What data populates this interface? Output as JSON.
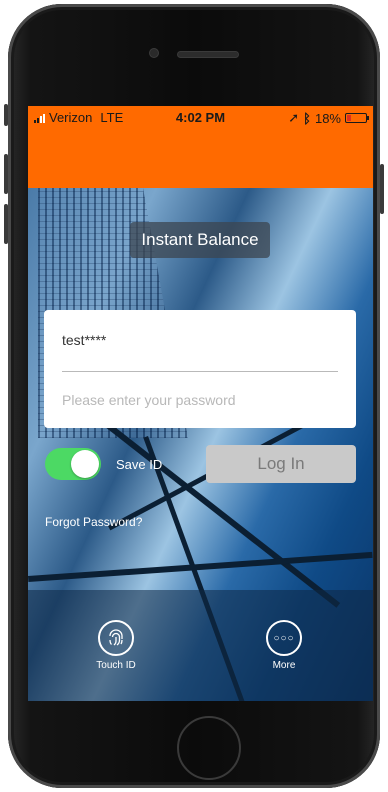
{
  "status_bar": {
    "carrier": "Verizon",
    "network": "LTE",
    "time": "4:02 PM",
    "battery": "18%",
    "icons": [
      "signal-icon",
      "location-icon",
      "bluetooth-icon",
      "battery-icon"
    ],
    "battery_color": "#e0301e"
  },
  "header": {
    "color": "#ff6a00"
  },
  "title": "Instant Balance",
  "login_form": {
    "username_value": "test****",
    "password_placeholder": "Please enter your password"
  },
  "save_id": {
    "label": "Save ID",
    "enabled": true,
    "toggle_color": "#4cd964"
  },
  "login_button": {
    "label": "Log In"
  },
  "forgot_password": "Forgot Password?",
  "bottom_actions": [
    {
      "label": "Touch ID",
      "icon": "fingerprint-icon"
    },
    {
      "label": "More",
      "icon": "more-dots-icon"
    }
  ]
}
